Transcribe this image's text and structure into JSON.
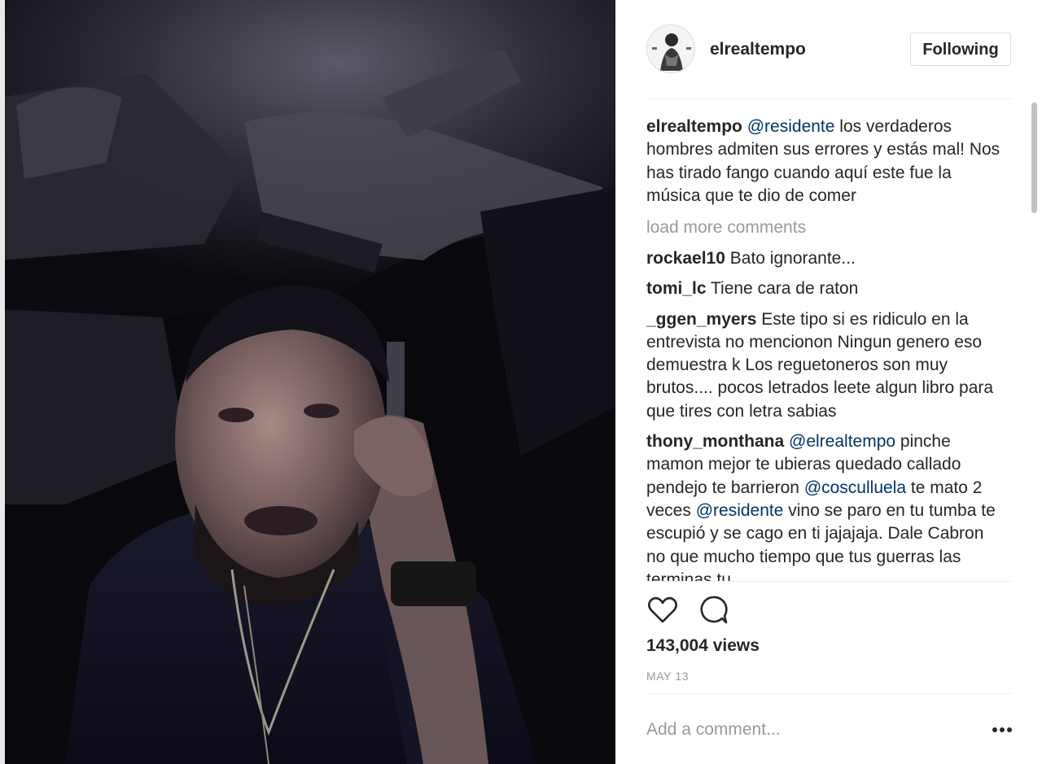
{
  "post": {
    "username": "elrealtempo",
    "follow_label": "Following",
    "caption": {
      "user": "elrealtempo",
      "mention": "@residente",
      "text": " los verdaderos hombres admiten sus errores y estás mal! Nos has tirado fango cuando aquí este fue la música que te dio de comer"
    },
    "load_more": "load more comments",
    "comments": [
      {
        "user": "rockael10",
        "parts": [
          " Bato ignorante..."
        ]
      },
      {
        "user": "tomi_lc",
        "parts": [
          " Tiene cara de raton"
        ]
      },
      {
        "user": "_ggen_myers",
        "parts": [
          " Este tipo si es ridiculo en la entrevista no mencionon Ningun genero eso demuestra k Los reguetoneros son muy brutos.... pocos letrados leete algun libro para que tires con letra sabias"
        ]
      },
      {
        "user": "thony_monthana",
        "mention1": "@elrealtempo",
        "t1": " pinche mamon mejor te ubieras quedado callado pendejo te barrieron ",
        "mention2": "@cosculluela",
        "t2": " te mato 2 veces ",
        "mention3": "@residente",
        "t3": " vino se paro en tu tumba te escupió y se cago en ti jajajaja. Dale Cabron no que mucho tiempo que tus guerras las terminas tu"
      }
    ],
    "views": "143,004 views",
    "date": "MAY 13",
    "add_comment_placeholder": "Add a comment..."
  },
  "icons": {
    "like": "heart-icon",
    "comment": "speech-bubble-icon",
    "more": "ellipsis-icon"
  },
  "colors": {
    "mention": "#003569",
    "muted": "#999999",
    "text": "#262626",
    "border": "#dbdbdb"
  }
}
